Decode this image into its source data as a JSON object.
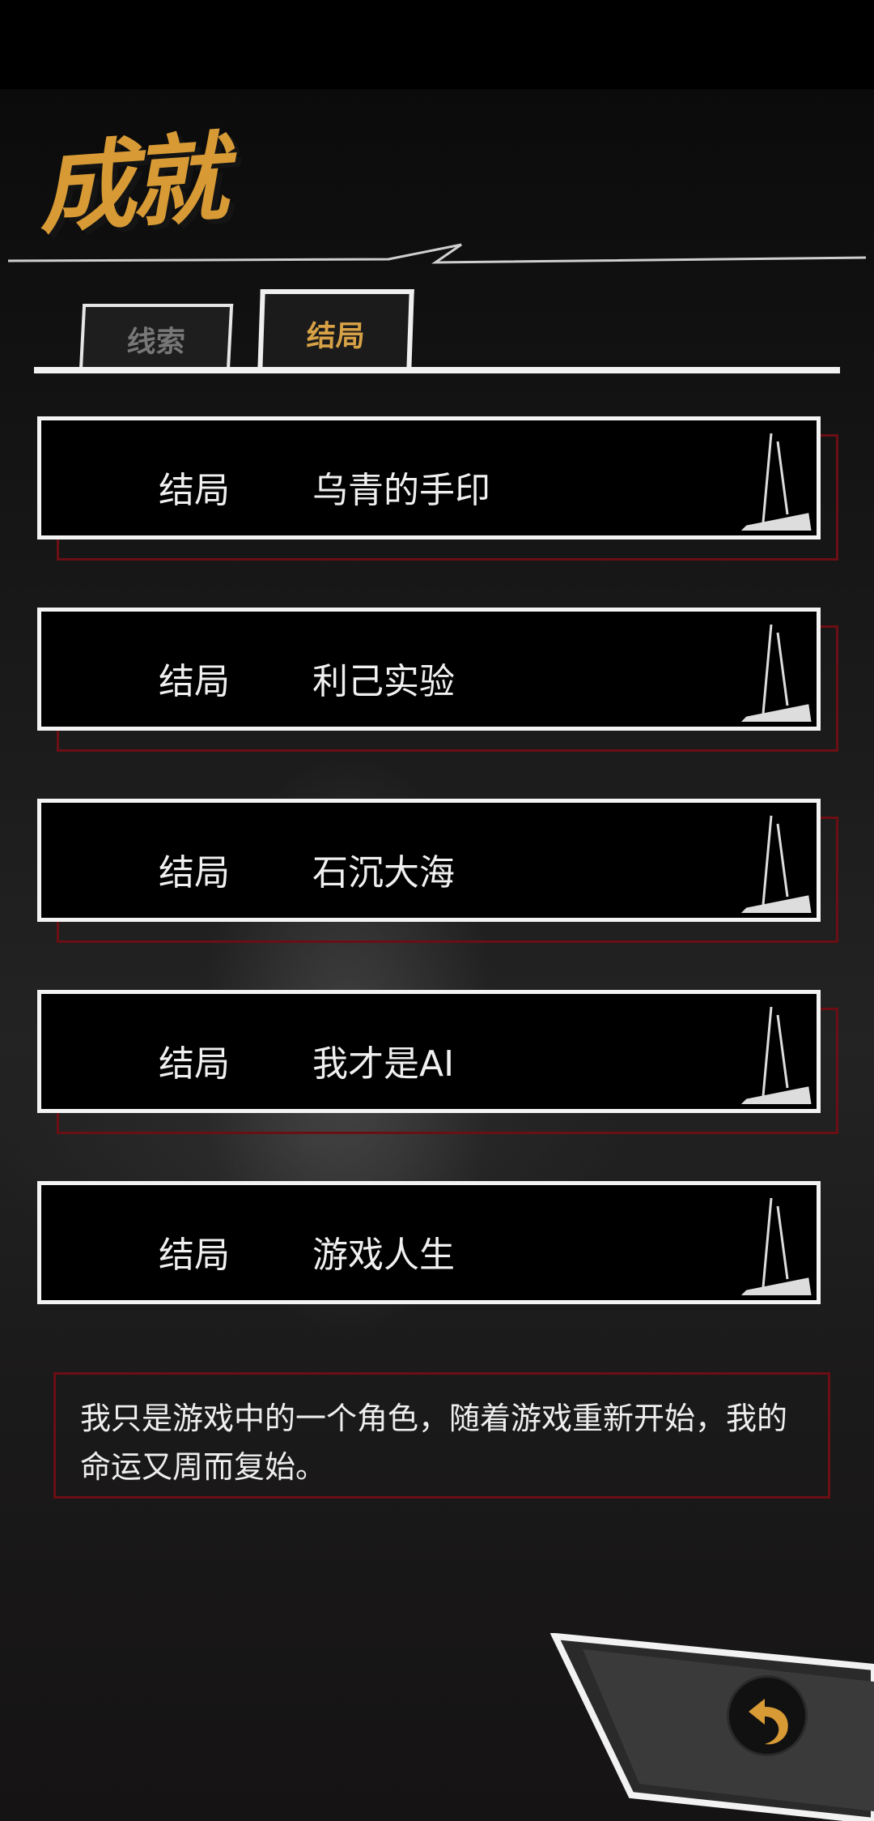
{
  "title": "成就",
  "tabs": [
    {
      "label": "线索",
      "active": false
    },
    {
      "label": "结局",
      "active": true
    }
  ],
  "endings": [
    {
      "label": "结局",
      "name": "乌青的手印"
    },
    {
      "label": "结局",
      "name": "利己实验"
    },
    {
      "label": "结局",
      "name": "石沉大海"
    },
    {
      "label": "结局",
      "name": "我才是AI"
    },
    {
      "label": "结局",
      "name": "游戏人生"
    }
  ],
  "description": "我只是游戏中的一个角色，随着游戏重新开始，我的命运又周而复始。",
  "colors": {
    "accent": "#d79a35",
    "border_red": "#6b0f14"
  },
  "icons": {
    "back": "undo-arrow-icon"
  }
}
